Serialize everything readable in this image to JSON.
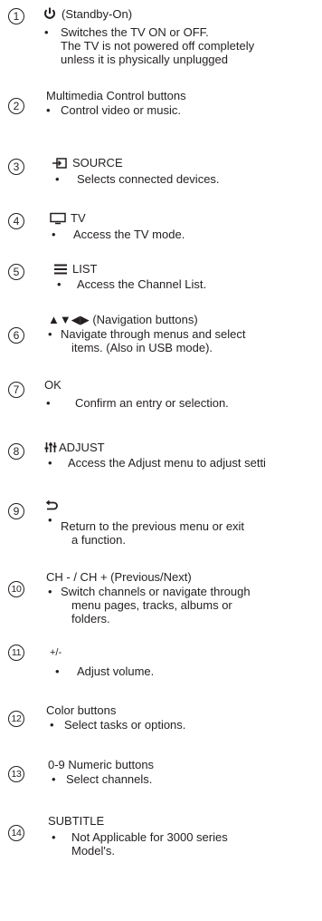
{
  "items": [
    {
      "number": "1",
      "icon": "power-icon",
      "title": "(Standby-On)",
      "lines": [
        "Switches the TV ON or OFF.",
        "The TV is not powered off completely",
        "unless it is physically unplugged"
      ]
    },
    {
      "number": "2",
      "title": "Multimedia Control buttons",
      "lines": [
        "Control video or music."
      ]
    },
    {
      "number": "3",
      "icon": "source-input-icon",
      "title": "SOURCE",
      "lines": [
        "Selects connected devices."
      ]
    },
    {
      "number": "4",
      "icon": "tv-icon",
      "title": "TV",
      "lines": [
        "Access the TV mode."
      ]
    },
    {
      "number": "5",
      "icon": "list-icon",
      "title": "LIST",
      "lines": [
        "Access the Channel List."
      ]
    },
    {
      "number": "6",
      "icon": "navigation-arrows-icon",
      "title": "▲▼◀▶ (Navigation buttons)",
      "lines": [
        "Navigate through menus and select",
        "items. (Also in USB mode)."
      ]
    },
    {
      "number": "7",
      "title": "OK",
      "lines": [
        "Confirm an entry or selection."
      ]
    },
    {
      "number": "8",
      "icon": "adjust-sliders-icon",
      "title": "ADJUST",
      "lines": [
        "Access the Adjust menu to adjust setti"
      ]
    },
    {
      "number": "9",
      "icon": "back-arrow-icon",
      "title": "",
      "lines": [
        "Return to the previous menu or exit",
        "a function."
      ]
    },
    {
      "number": "10",
      "title": "CH - / CH + (Previous/Next)",
      "lines": [
        "Switch channels or navigate through",
        "menu pages, tracks, albums or",
        "folders."
      ]
    },
    {
      "number": "11",
      "title": "+/-",
      "lines": [
        "Adjust volume."
      ]
    },
    {
      "number": "12",
      "title": "Color buttons",
      "lines": [
        "Select tasks or options."
      ]
    },
    {
      "number": "13",
      "title": "0-9 Numeric buttons",
      "lines": [
        "Select channels."
      ]
    },
    {
      "number": "14",
      "title": "SUBTITLE",
      "lines": [
        "Not Applicable for 3000 series",
        "Model's."
      ]
    }
  ]
}
